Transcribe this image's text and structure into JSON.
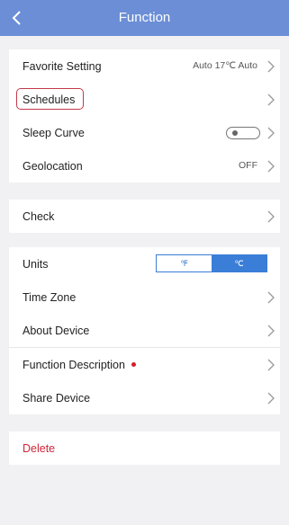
{
  "header": {
    "title": "Function",
    "back_icon": "chevron-left-icon"
  },
  "group1": {
    "favorite_label": "Favorite Setting",
    "favorite_value": "Auto 17℃ Auto",
    "schedules_label": "Schedules",
    "sleep_label": "Sleep Curve",
    "sleep_toggle_on": false,
    "geo_label": "Geolocation",
    "geo_value": "OFF"
  },
  "group2": {
    "check_label": "Check"
  },
  "group3": {
    "units_label": "Units",
    "unit_f": "℉",
    "unit_c": "℃",
    "unit_selected": "℃",
    "timezone_label": "Time Zone",
    "about_label": "About Device",
    "description_label": "Function Description",
    "share_label": "Share Device"
  },
  "group4": {
    "delete_label": "Delete"
  },
  "colors": {
    "header_bg": "#6b8ed6",
    "accent_blue": "#3a7ed8",
    "delete_red": "#d0253a",
    "highlight_red": "#c23a4a",
    "background": "#f1f1f3"
  }
}
